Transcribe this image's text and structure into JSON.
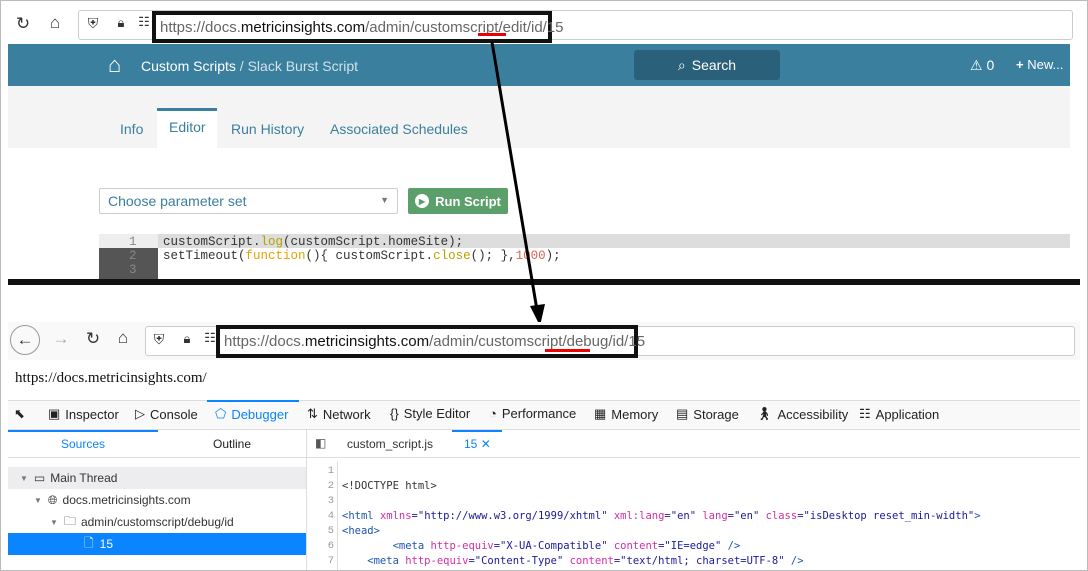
{
  "top_browser": {
    "url_prefix": "https://docs.",
    "url_domain": "metricinsights.com",
    "url_path_before": "/admin/customscript/",
    "url_highlight": "edit",
    "url_path_after": "/id/15"
  },
  "app_header": {
    "breadcrumb_parent": "Custom Scripts",
    "breadcrumb_separator": " / ",
    "breadcrumb_current": "Slack Burst Script",
    "search_label": "Search",
    "alerts_count": "0",
    "new_label": "New..."
  },
  "tabs": [
    {
      "label": "Info"
    },
    {
      "label": "Editor",
      "active": true
    },
    {
      "label": "Run History"
    },
    {
      "label": "Associated Schedules"
    }
  ],
  "editor": {
    "param_select_placeholder": "Choose parameter set",
    "run_button_label": "Run Script",
    "lines": [
      {
        "n": "1",
        "a": "customScript.",
        "b": "log",
        "c": "(customScript.homeSite);"
      },
      {
        "n": "2",
        "a": "setTimeout(",
        "b": "function",
        "c": "(){ customScript.",
        "d": "close",
        "e": "(); },",
        "f": "1000",
        "g": ");"
      },
      {
        "n": "3"
      }
    ]
  },
  "bottom_browser": {
    "url_prefix": "https://docs.",
    "url_domain": "metricinsights.com",
    "url_path_before": "/admin/customscript/",
    "url_highlight": "debug",
    "url_path_after": "/id/15",
    "page_text": "https://docs.metricinsights.com/"
  },
  "devtools": {
    "tabs": [
      "Inspector",
      "Console",
      "Debugger",
      "Network",
      "Style Editor",
      "Performance",
      "Memory",
      "Storage",
      "Accessibility",
      "Application"
    ],
    "active_tab": "Debugger",
    "left_tabs": [
      "Sources",
      "Outline"
    ],
    "tree": [
      "Main Thread",
      "docs.metricinsights.com",
      "admin/customscript/debug/id",
      "15"
    ],
    "file_tabs": [
      "custom_script.js",
      "15"
    ],
    "source_lines": [
      {
        "n": "1",
        "text": ""
      },
      {
        "n": "2",
        "text": "<!DOCTYPE html>"
      },
      {
        "n": "3",
        "text": ""
      },
      {
        "n": "4",
        "tag": "<html ",
        "a1": "xmlns",
        "v1": "=\"http://www.w3.org/1999/xhtml\" ",
        "a2": "xml:lang",
        "v2": "=\"en\" ",
        "a3": "lang",
        "v3": "=\"en\" ",
        "a4": "class",
        "v4": "=\"isDesktop reset_min-width\"",
        "end": ">"
      },
      {
        "n": "5",
        "tag": "<head>"
      },
      {
        "n": "6",
        "tag": "        <meta ",
        "a1": "http-equiv",
        "v1": "=\"X-UA-Compatible\" ",
        "a2": "content",
        "v2": "=\"IE=edge\" ",
        "end": "/>"
      },
      {
        "n": "7",
        "tag": "    <meta ",
        "a1": "http-equiv",
        "v1": "=\"Content-Type\" ",
        "a2": "content",
        "v2": "=\"text/html; charset=UTF-8\" ",
        "end": "/>"
      }
    ]
  },
  "colors": {
    "header": "#3a7f9e",
    "run_button": "#5ba06a",
    "highlight": "#e00000",
    "devtools_accent": "#0a84ff"
  }
}
